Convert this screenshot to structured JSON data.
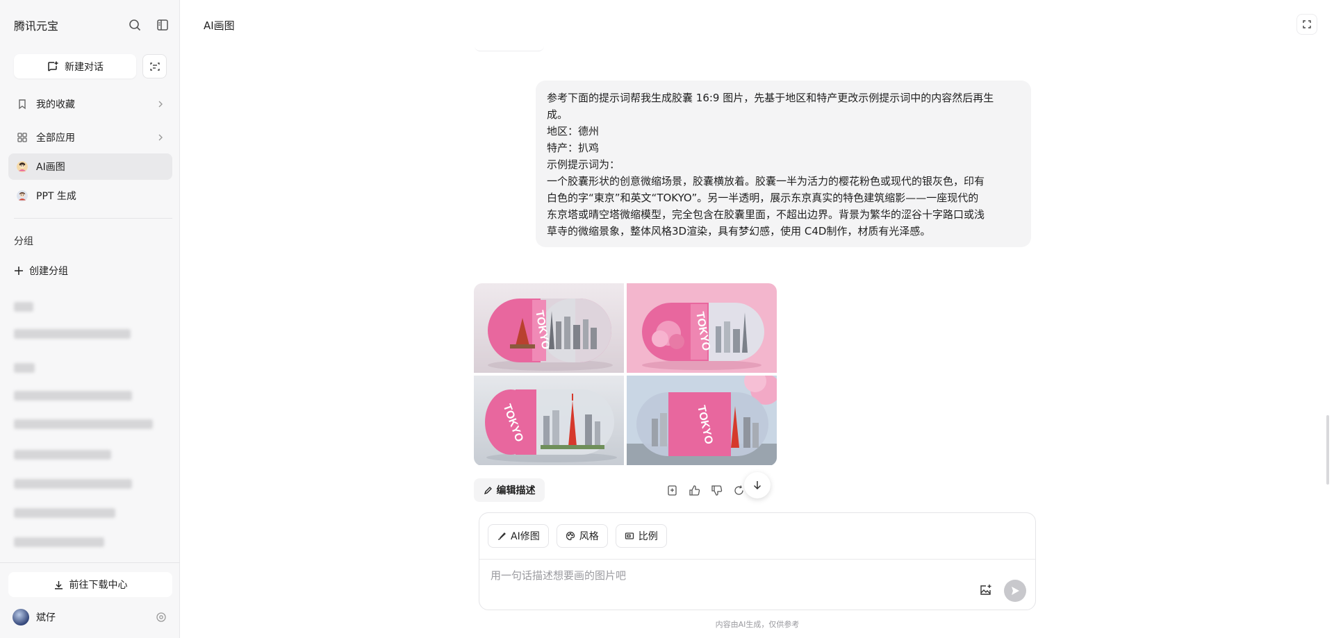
{
  "sidebar": {
    "app_title": "腾讯元宝",
    "new_chat_label": "新建对话",
    "items": [
      {
        "label": "我的收藏",
        "icon": "bookmark-icon"
      },
      {
        "label": "全部应用",
        "icon": "apps-icon"
      },
      {
        "label": "AI画图",
        "icon": "ai-draw-avatar"
      },
      {
        "label": "PPT 生成",
        "icon": "ppt-avatar"
      }
    ],
    "group_title": "分组",
    "create_group_label": "创建分组",
    "download_center_label": "前往下载中心",
    "user_name": "斌仔"
  },
  "header": {
    "title": "AI画图"
  },
  "conversation": {
    "user_message_lines": [
      "参考下面的提示词帮我生成胶囊 16:9 图片，先基于地区和特产更改示例提示词中的内容然后再生",
      "成。",
      "地区：德州",
      "特产：扒鸡",
      "示例提示词为：",
      "一个胶囊形状的创意微缩场景，胶囊横放着。胶囊一半为活力的樱花粉色或现代的银灰色，印有",
      "白色的字“東京”和英文“TOKYO”。另一半透明，展示东京真实的特色建筑缩影——一座现代的",
      "东京塔或晴空塔微缩模型，完全包含在胶囊里面，不超出边界。背景为繁华的涩谷十字路口或浅",
      "草寺的微缩景象，整体风格3D渲染，具有梦幻感，使用 C4D制作，材质有光泽感。"
    ],
    "image_label": "TOKYO",
    "edit_description_label": "编辑描述"
  },
  "composer": {
    "tools": [
      "AI修图",
      "风格",
      "比例"
    ],
    "placeholder": "用一句话描述想要画的图片吧",
    "disclaimer": "内容由AI生成，仅供参考"
  },
  "colors": {
    "pink": "#e8679e",
    "light_pink": "#f3a9c8",
    "bg_sidebar": "#f7f7f8",
    "send_disabled": "#c8c8cc"
  }
}
